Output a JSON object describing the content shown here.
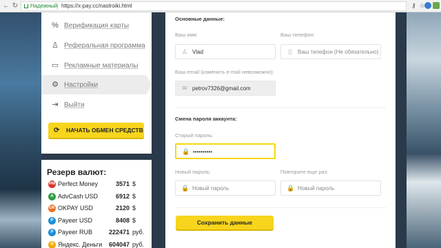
{
  "browser": {
    "secure_label": "Надежный",
    "url": "https://x-pay.cc/nastroiki.html",
    "icons": [
      "back-icon",
      "reload-icon",
      "lock-icon",
      "key-icon",
      "star-icon"
    ]
  },
  "sidebar": {
    "items": [
      {
        "label": "Верификация карты",
        "icon": "%"
      },
      {
        "label": "Реферальная программа",
        "icon": "♙"
      },
      {
        "label": "Рекламные материалы",
        "icon": "▭"
      },
      {
        "label": "Настройки",
        "icon": "⚙"
      },
      {
        "label": "Выйти",
        "icon": "⇥"
      }
    ],
    "exchange_button": "НАЧАТЬ ОБМЕН СРЕДСТВ"
  },
  "reserve": {
    "title": "Резерв валют:",
    "rows": [
      {
        "name": "Perfect Money",
        "amount": "3571",
        "unit": "$",
        "icon_text": "PM",
        "color": "#d9342b"
      },
      {
        "name": "AdvCash USD",
        "amount": "6912",
        "unit": "$",
        "icon_text": "A",
        "color": "#2e9e44"
      },
      {
        "name": "OKPAY USD",
        "amount": "2120",
        "unit": "$",
        "icon_text": "OK",
        "color": "#ef6b1f"
      },
      {
        "name": "Payeer USD",
        "amount": "8408",
        "unit": "$",
        "icon_text": "P",
        "color": "#1a8fd8"
      },
      {
        "name": "Payeer RUB",
        "amount": "222471",
        "unit": "руб.",
        "icon_text": "P",
        "color": "#1a8fd8"
      },
      {
        "name": "Яндекс. Деньги",
        "amount": "604047",
        "unit": "руб.",
        "icon_text": "Я",
        "color": "#f2a900"
      }
    ]
  },
  "form": {
    "basic_title": "Основные данные:",
    "name_label": "Ваш имя:",
    "name_value": "Vlad",
    "phone_label": "Ваш телефон:",
    "phone_placeholder": "Ваш телефон (Не обязательно)",
    "email_label": "Ваш email (изменить e-mail невозможно):",
    "email_value": "petrov7326@gmail.com",
    "password_title": "Смена пароля аккаунта:",
    "old_password_label": "Старый пароль:",
    "old_password_value": "••••••••••",
    "new_password_label": "Новый пароль:",
    "new_password_placeholder": "Новый пароль",
    "repeat_label": "Повторите еще раз:",
    "repeat_placeholder": "Новый пароль",
    "save_button": "Сохранить данные"
  }
}
